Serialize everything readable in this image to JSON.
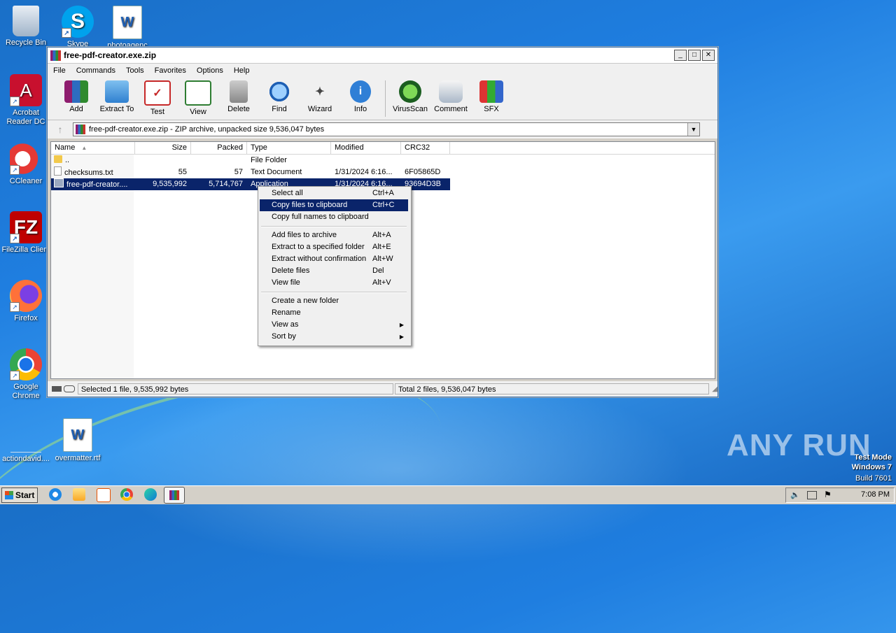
{
  "desktop": {
    "icons": [
      {
        "label": "Recycle Bin"
      },
      {
        "label": "Skype"
      },
      {
        "label": "photoagenc"
      },
      {
        "label": "Acrobat Reader DC"
      },
      {
        "label": "CCleaner"
      },
      {
        "label": "FileZilla Client"
      },
      {
        "label": "Firefox"
      },
      {
        "label": "Google Chrome"
      },
      {
        "label": "actiondavid...."
      },
      {
        "label": "overmatter.rtf"
      }
    ],
    "watermark": "ANY RUN",
    "test_mode": {
      "line1": "Test Mode",
      "line2": "Windows 7",
      "line3": "Build 7601"
    }
  },
  "window": {
    "title": "free-pdf-creator.exe.zip",
    "menu": [
      "File",
      "Commands",
      "Tools",
      "Favorites",
      "Options",
      "Help"
    ],
    "toolbar": [
      "Add",
      "Extract To",
      "Test",
      "View",
      "Delete",
      "Find",
      "Wizard",
      "Info",
      "VirusScan",
      "Comment",
      "SFX"
    ],
    "address": "free-pdf-creator.exe.zip - ZIP archive, unpacked size 9,536,047 bytes",
    "columns": [
      "Name",
      "Size",
      "Packed",
      "Type",
      "Modified",
      "CRC32"
    ],
    "rows": [
      {
        "name": "..",
        "size": "",
        "packed": "",
        "type": "File Folder",
        "modified": "",
        "crc": ""
      },
      {
        "name": "checksums.txt",
        "size": "55",
        "packed": "57",
        "type": "Text Document",
        "modified": "1/31/2024 6:16...",
        "crc": "6F05865D"
      },
      {
        "name": "free-pdf-creator....",
        "size": "9,535,992",
        "packed": "5,714,767",
        "type": "Application",
        "modified": "1/31/2024 6:16...",
        "crc": "93694D3B"
      }
    ],
    "status_left": "Selected 1 file, 9,535,992 bytes",
    "status_right": "Total 2 files, 9,536,047 bytes"
  },
  "context_menu": {
    "group1": [
      {
        "label": "Select all",
        "shortcut": "Ctrl+A"
      },
      {
        "label": "Copy files to clipboard",
        "shortcut": "Ctrl+C"
      },
      {
        "label": "Copy full names to clipboard",
        "shortcut": ""
      }
    ],
    "group2": [
      {
        "label": "Add files to archive",
        "shortcut": "Alt+A"
      },
      {
        "label": "Extract to a specified folder",
        "shortcut": "Alt+E"
      },
      {
        "label": "Extract without confirmation",
        "shortcut": "Alt+W"
      },
      {
        "label": "Delete files",
        "shortcut": "Del"
      },
      {
        "label": "View file",
        "shortcut": "Alt+V"
      }
    ],
    "group3": [
      {
        "label": "Create a new folder"
      },
      {
        "label": "Rename"
      },
      {
        "label": "View as"
      },
      {
        "label": "Sort by"
      }
    ]
  },
  "taskbar": {
    "start": "Start",
    "clock": "7:08 PM"
  }
}
